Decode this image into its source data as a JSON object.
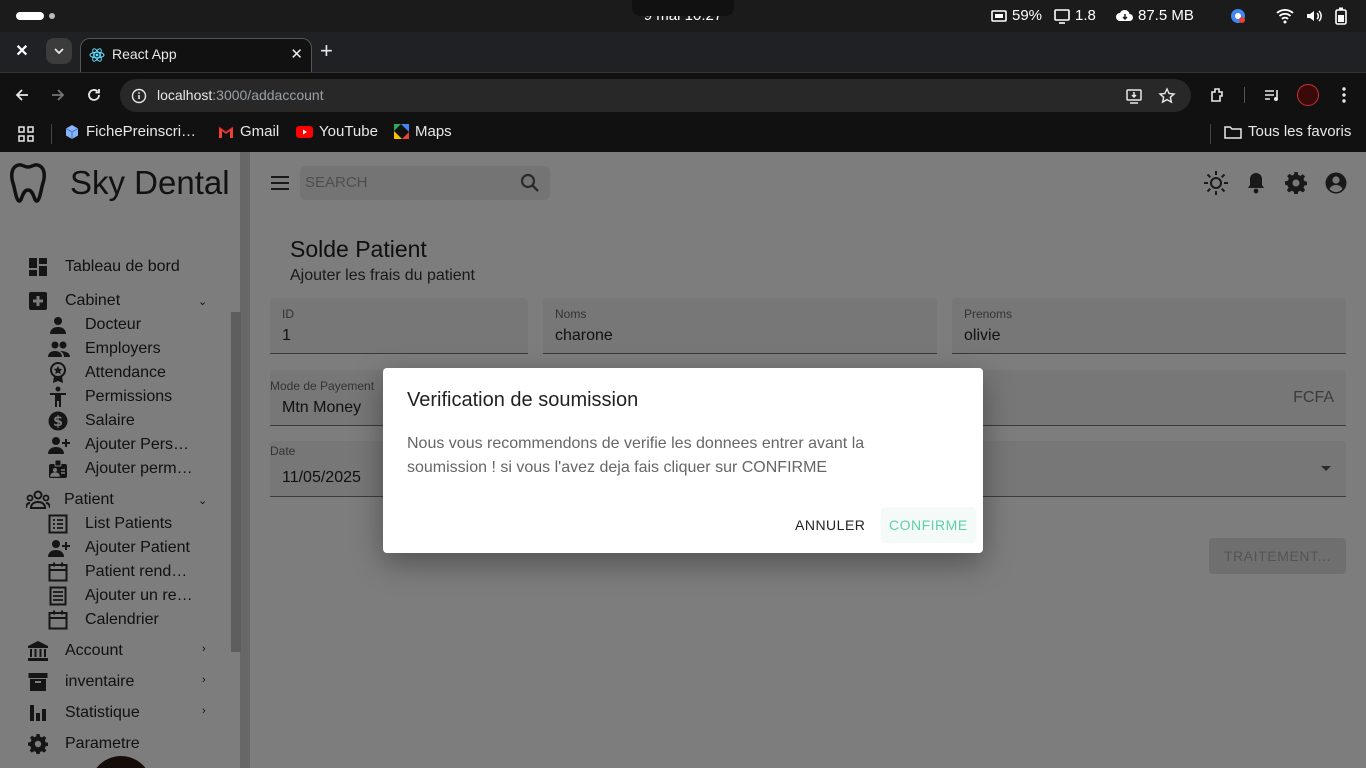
{
  "os": {
    "clock": "9 mai  10:27",
    "cpu": "59%",
    "load": "1.8",
    "net": "87.5 MB"
  },
  "browser": {
    "tab_title": "React App",
    "url_host": "localhost",
    "url_path": ":3000/addaccount",
    "bookmarks": [
      {
        "label": "FichePreinscri…",
        "icon": "cube-icon"
      },
      {
        "label": "Gmail",
        "icon": "gmail-icon"
      },
      {
        "label": "YouTube",
        "icon": "youtube-icon"
      },
      {
        "label": "Maps",
        "icon": "maps-icon"
      }
    ],
    "all_bookmarks": "Tous les favoris"
  },
  "sidebar": {
    "brand": "Sky Dental",
    "items": [
      {
        "label": "Tableau de bord",
        "icon": "dashboard-icon"
      },
      {
        "label": "Cabinet",
        "icon": "medical-plus-icon",
        "expanded": true
      },
      {
        "label": "Docteur",
        "icon": "person-icon"
      },
      {
        "label": "Employers",
        "icon": "group-icon"
      },
      {
        "label": "Attendance",
        "icon": "badge-icon"
      },
      {
        "label": "Permissions",
        "icon": "accessibility-icon"
      },
      {
        "label": "Salaire",
        "icon": "dollar-icon"
      },
      {
        "label": "Ajouter Pers…",
        "icon": "person-add-icon"
      },
      {
        "label": "Ajouter perm…",
        "icon": "id-card-icon"
      },
      {
        "label": "Patient",
        "icon": "groups-icon",
        "expanded": true
      },
      {
        "label": "List Patients",
        "icon": "list-icon"
      },
      {
        "label": "Ajouter Patient",
        "icon": "person-add-icon"
      },
      {
        "label": "Patient rend…",
        "icon": "calendar-icon"
      },
      {
        "label": "Ajouter un re…",
        "icon": "notes-icon"
      },
      {
        "label": "Calendrier",
        "icon": "calendar-icon"
      },
      {
        "label": "Account",
        "icon": "bank-icon"
      },
      {
        "label": "inventaire",
        "icon": "archive-icon"
      },
      {
        "label": "Statistique",
        "icon": "bar-chart-icon"
      },
      {
        "label": "Parametre",
        "icon": "gear-icon"
      }
    ]
  },
  "header": {
    "search_placeholder": "SEARCH"
  },
  "page": {
    "title": "Solde Patient",
    "subtitle": "Ajouter les frais du patient"
  },
  "form": {
    "id_label": "ID",
    "id_value": "1",
    "noms_label": "Noms",
    "noms_value": "charone",
    "prenoms_label": "Prenoms",
    "prenoms_value": "olivie",
    "mode_label": "Mode de Payement",
    "mode_value": "Mtn Money",
    "amount_suffix": "FCFA",
    "date_label": "Date",
    "date_value": "11/05/2025",
    "submit_label": "TRAITEMENT..."
  },
  "dialog": {
    "title": "Verification de soumission",
    "text": "Nous vous recommendons de verifie les donnees entrer avant la soumission ! si vous l'avez deja fais cliquer sur CONFIRME",
    "cancel": "ANNULER",
    "confirm": "CONFIRME"
  },
  "colors": {
    "accent": "#5fcfae",
    "overlay": "rgba(0,0,0,0.5)"
  }
}
